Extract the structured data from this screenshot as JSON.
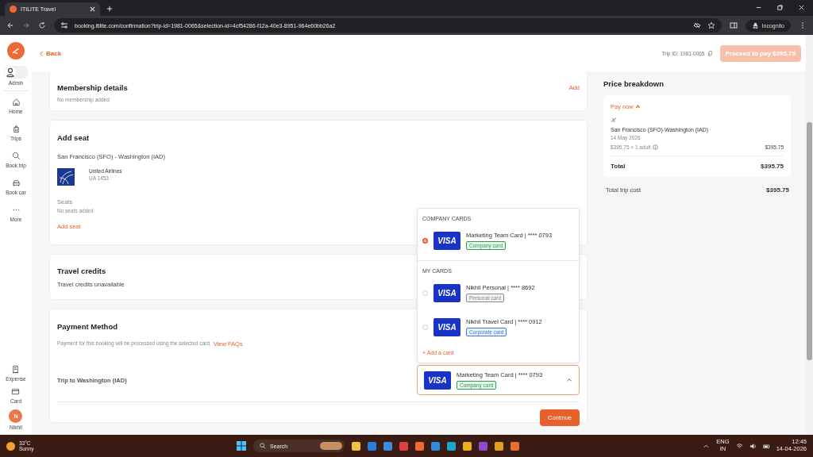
{
  "browser": {
    "tab_title": "ITILITE Travel",
    "url": "booking.itilite.com/confirmation?trip-id=1981-0065&selection-id=4cf54286-f12a-40e3-8951-964e60bb26a2",
    "profile": "Incognito"
  },
  "header": {
    "back": "Back",
    "trip_id": "Trip ID: 1981-0065",
    "proceed_button": "Proceed to pay $395.75",
    "proceed_disabled": true
  },
  "sidebar": {
    "role": "Admin",
    "role_toggle_on": false,
    "items": [
      {
        "kind": "home",
        "label": "Home"
      },
      {
        "kind": "trips",
        "label": "Trips"
      },
      {
        "kind": "search",
        "label": "Book trip"
      },
      {
        "kind": "car",
        "label": "Book car"
      },
      {
        "kind": "more",
        "label": "More"
      }
    ],
    "bottom_items": [
      {
        "kind": "expense",
        "label": "Expense"
      },
      {
        "kind": "card",
        "label": "Card"
      }
    ],
    "user": {
      "initial": "N",
      "name": "Nikhil"
    }
  },
  "membership": {
    "title": "Membership details",
    "link": "Add",
    "text": "No membership added"
  },
  "seat": {
    "title": "Add seat",
    "route": "San Francisco (SFO) - Washington (IAD)",
    "airline": "United Airlines",
    "flight": "UA 1453",
    "seats_label": "Seats",
    "seats_text": "No seats added",
    "add_link": "Add seat"
  },
  "credits": {
    "title": "Travel credits",
    "text": "Travel credits unavailable"
  },
  "payment": {
    "title": "Payment Method",
    "note": "Payment for this booking will be processed using the selected card.",
    "faq_link": "View FAQs",
    "trip_label": "Trip to Washington (IAD)",
    "expanded": true,
    "selected_card": {
      "network": "VISA",
      "name": "Marketing Team Card | **** 0793",
      "tag": "Company card",
      "color": "#2e9b55"
    },
    "continue_button": "Continue"
  },
  "dropdown": {
    "groups": [
      {
        "heading": "COMPANY CARDS",
        "cards": [
          {
            "network": "VISA",
            "name": "Marketing Team Card | **** 0793",
            "tag": "Company card",
            "color": "#2e9b55",
            "selected": true
          }
        ]
      },
      {
        "heading": "MY CARDS",
        "cards": [
          {
            "network": "VISA",
            "name": "Nikhil Personal | **** 8692",
            "tag": "Personal card",
            "color": "#888888",
            "selected": false
          },
          {
            "network": "VISA",
            "name": "Nikhil Travel Card | **** 0912",
            "tag": "Corporate card",
            "color": "#3a7ad9",
            "selected": false
          }
        ]
      }
    ],
    "add_card": "+ Add a card"
  },
  "price": {
    "title": "Price breakdown",
    "pay_now": "Pay now",
    "route": "San Francisco (SFO)-Washington (IAD)",
    "date": "14 May 2026",
    "line_label": "$395.75 × 1 adult",
    "line_amount": "$395.75",
    "total_label": "Total",
    "total_value": "$395.75",
    "trip_cost_label": "Total trip cost",
    "trip_cost_value": "$395.75"
  },
  "taskbar": {
    "temp": "33°C",
    "weather": "Sunny",
    "search": "Search",
    "lang": "ENG",
    "region": "IN",
    "time": "12:45",
    "date": "14-04-2026"
  }
}
